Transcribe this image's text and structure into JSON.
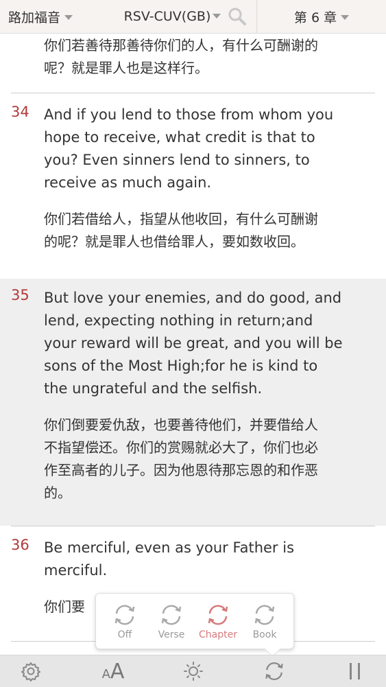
{
  "header": {
    "book": "路加福音",
    "version": "RSV-CUV(GB)",
    "chapter": "第 6 章"
  },
  "verses": [
    {
      "number": "",
      "en_lines": [],
      "zh_lines": [
        "你们若善待那善待你们的人，有什么可酬谢的",
        "呢？就是罪人也是这样行。"
      ]
    },
    {
      "number": "34",
      "en_lines": [
        "And if you lend to those from whom you",
        "hope to receive, what credit is that to",
        "you? Even sinners lend to sinners, to",
        "receive as much again."
      ],
      "zh_lines": [
        "你们若借给人，指望从他收回，有什么可酬谢",
        "的呢？就是罪人也借给罪人，要如数收回。"
      ]
    },
    {
      "number": "35",
      "en_lines": [
        "But love your enemies, and do good, and",
        "lend, expecting nothing in return;and",
        "your reward will be great, and you will be",
        "sons of the Most High;for he is kind to",
        "the ungrateful and the selfish."
      ],
      "zh_lines": [
        "你们倒要爱仇敌，也要善待他们，并要借给人",
        "不指望偿还。你们的赏赐就必大了，你们也必",
        "作至高者的儿子。因为他恩待那忘恩的和作恶",
        "的。"
      ]
    },
    {
      "number": "36",
      "en_lines": [
        "Be merciful, even as your Father is",
        "merciful."
      ],
      "zh_lines": [
        "你们要"
      ]
    }
  ],
  "sync_popup": {
    "options": [
      "Off",
      "Verse",
      "Chapter",
      "Book"
    ],
    "active": "Chapter"
  },
  "toolbar": {
    "font_small": "A",
    "font_large": "A"
  },
  "colors": {
    "verse_number": "#b33a3a",
    "active_option": "#d67a7a",
    "highlight_bg": "#efefef"
  }
}
